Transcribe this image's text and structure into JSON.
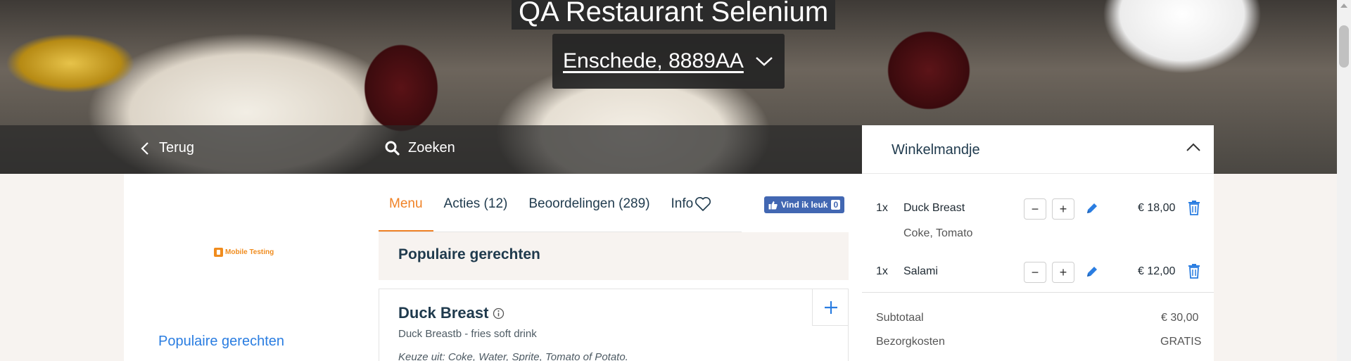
{
  "hero": {
    "title": "QA Restaurant Selenium",
    "location": "Enschede, 8889AA"
  },
  "nav": {
    "back_label": "Terug",
    "search_label": "Zoeken"
  },
  "sidebar": {
    "logo_text": "Mobile Testing",
    "links": [
      {
        "label": "Populaire gerechten"
      }
    ]
  },
  "tabs": [
    {
      "label": "Menu",
      "active": true
    },
    {
      "label": "Acties (12)",
      "active": false
    },
    {
      "label": "Beoordelingen (289)",
      "active": false
    },
    {
      "label": "Info",
      "active": false
    }
  ],
  "facebook": {
    "label": "Vind ik leuk",
    "count": "0"
  },
  "menu": {
    "section_title": "Populaire gerechten",
    "dishes": [
      {
        "name": "Duck Breast",
        "description": "Duck Breastb - fries soft drink",
        "options": "Keuze uit: Coke, Water, Sprite, Tomato of Potato."
      }
    ]
  },
  "basket": {
    "title": "Winkelmandje",
    "items": [
      {
        "qty": "1x",
        "name": "Duck Breast",
        "extras": "Coke, Tomato",
        "price": "€ 18,00"
      },
      {
        "qty": "1x",
        "name": "Salami",
        "extras": "",
        "price": "€ 12,00"
      }
    ],
    "summary": [
      {
        "label": "Subtotaal",
        "value": "€ 30,00"
      },
      {
        "label": "Bezorgkosten",
        "value": "GRATIS"
      }
    ]
  },
  "colors": {
    "accent_orange": "#f08226",
    "link_blue": "#2a7de1",
    "facebook_blue": "#4267b2",
    "heading_navy": "#1f3a4d"
  }
}
